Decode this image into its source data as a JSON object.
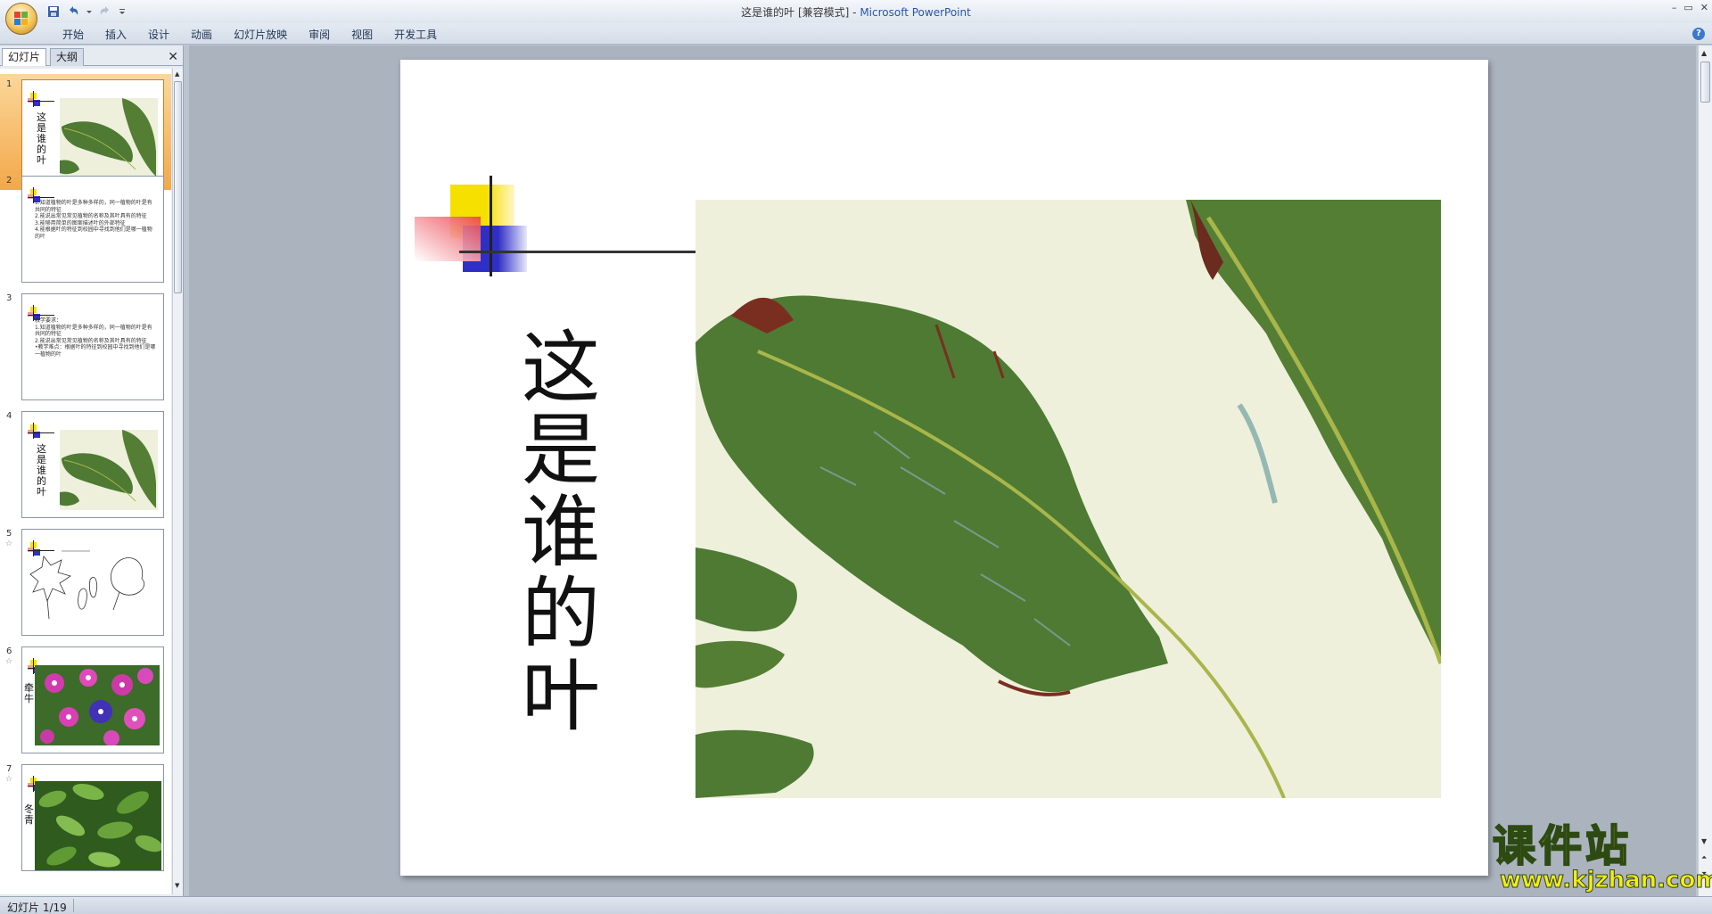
{
  "window": {
    "title": "这是谁的叶 [兼容模式]",
    "title_sep": " - ",
    "app_name": "Microsoft PowerPoint",
    "controls": [
      "–",
      "▭",
      "✕"
    ]
  },
  "ribbon": {
    "tabs": [
      "开始",
      "插入",
      "设计",
      "动画",
      "幻灯片放映",
      "审阅",
      "视图",
      "开发工具"
    ]
  },
  "left_panel": {
    "tabs": [
      "幻灯片",
      "大纲"
    ],
    "close": "✕",
    "slides": [
      {
        "number": "1",
        "title": "这是谁的叶",
        "anim": ""
      },
      {
        "number": "2",
        "title": "",
        "anim": "",
        "lines": [
          "1.知道植物的叶是多种多样的，同一植物的叶是有共同的特征",
          "2.能说出常见常见植物的名称及其叶具有的特征",
          "3.能够用简单的图案描述叶的外部特征",
          "4.能根据叶的特征到校园中寻找到他们是哪一植物的叶"
        ]
      },
      {
        "number": "3",
        "title": "",
        "anim": "",
        "lines": [
          "教学要求：",
          "1.知道植物的叶是多种多样的，同一植物的叶是有共同的特征",
          "2.能说出常见常见植物的名称及其叶具有的特征",
          "•教学难点：根据叶的特征到校园中寻找到他们是哪一植物的叶"
        ]
      },
      {
        "number": "4",
        "title": "这是谁的叶",
        "anim": ""
      },
      {
        "number": "5",
        "title": "",
        "anim": "☆"
      },
      {
        "number": "6",
        "title": "牵牛",
        "anim": "☆"
      },
      {
        "number": "7",
        "title": "冬青",
        "anim": "☆"
      }
    ]
  },
  "slide": {
    "title_chars": [
      "这",
      "是",
      "谁",
      "的",
      "叶"
    ]
  },
  "watermark": {
    "cn": "课件站",
    "url": "www.kjzhan.com"
  },
  "status": {
    "slide_count": "幻灯片 1/19"
  },
  "colors": {
    "accent_yellow": "#f5e000",
    "accent_blue": "#2f2fc8",
    "accent_pink": "#f28a93",
    "leaf_green": "#4e7a33",
    "leaf_bg": "#eef0dc"
  }
}
